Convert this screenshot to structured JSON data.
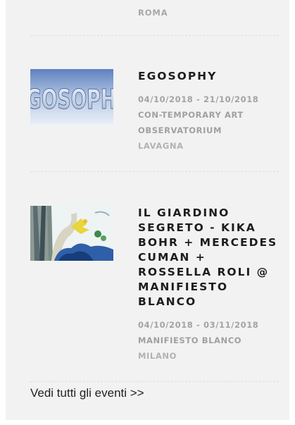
{
  "events": [
    {
      "city": "ROMA"
    },
    {
      "title": "EGOSOPHY",
      "dates": "04/10/2018 - 21/10/2018",
      "venue_line1": "CON-TEMPORARY ART",
      "venue_line2": "OBSERVATORIUM",
      "city": "LAVAGNA",
      "thumb_text": "GOSOPH"
    },
    {
      "title": "IL GIARDINO SEGRETO - KIKA BOHR + MERCEDES CUMAN + ROSSELLA ROLI @ MANIFIESTO BLANCO",
      "dates": "04/10/2018 - 03/11/2018",
      "venue_line1": "MANIFIESTO BLANCO",
      "city": "MILANO"
    }
  ],
  "see_all_label": "Vedi tutti gli eventi >>",
  "colors": {
    "panel_bg": "#f2f2f2",
    "title": "#1d1d1d",
    "meta": "#a3a3a3",
    "link": "#222222"
  }
}
